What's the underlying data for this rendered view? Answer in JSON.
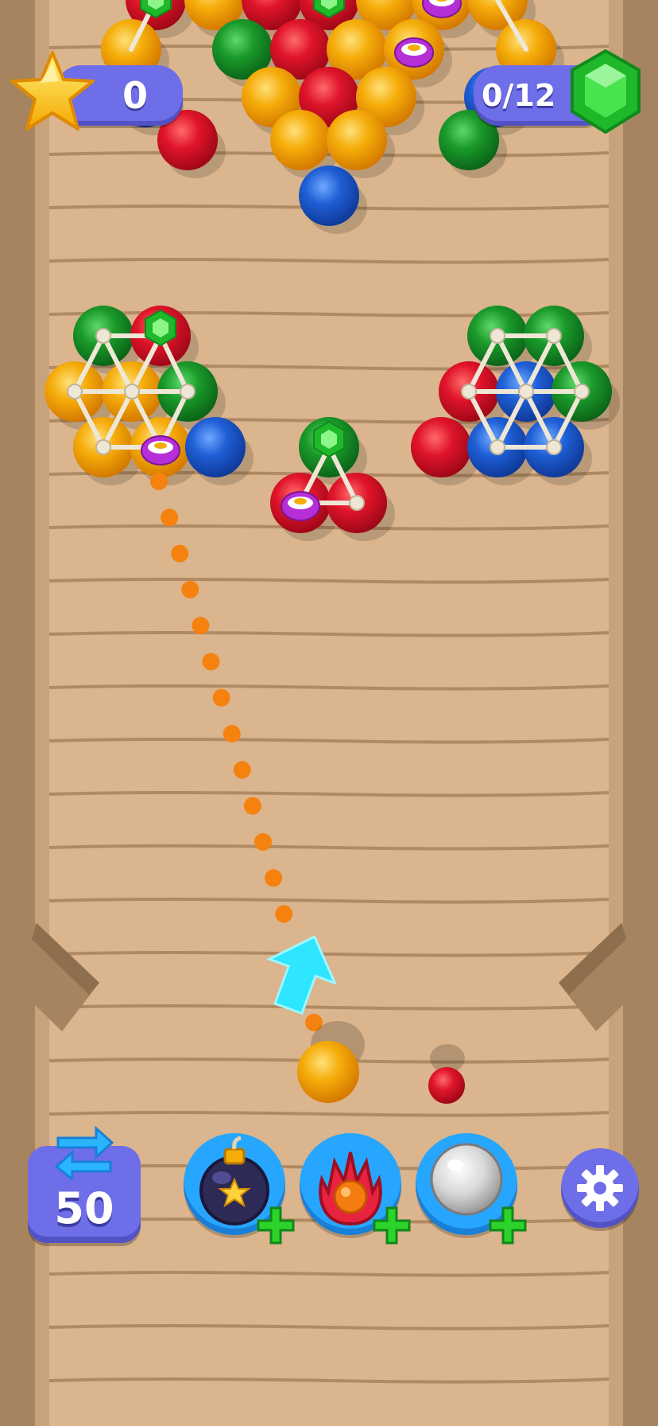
{
  "hud": {
    "score": "0",
    "gem_goal": "0/12",
    "moves_left": "50"
  },
  "boosters": [
    {
      "name": "bomb",
      "icon": "bomb-icon"
    },
    {
      "name": "fire",
      "icon": "fire-ball-icon"
    },
    {
      "name": "silver",
      "icon": "silver-ball-icon"
    }
  ],
  "colors": {
    "board": "#d9b48c",
    "red": "#e0142a",
    "yellow": "#f5ad0a",
    "green": "#1a9a2a",
    "blue": "#1f5fd6",
    "aim_dots": "#f5820f",
    "aim_arrow": "#2ee6ff",
    "hud_purple": "#6e6ee8",
    "booster_blue": "#27a6ff",
    "gem_green": "#3ee040"
  },
  "shooter": {
    "current_ball": "yellow",
    "next_ball": "red"
  }
}
